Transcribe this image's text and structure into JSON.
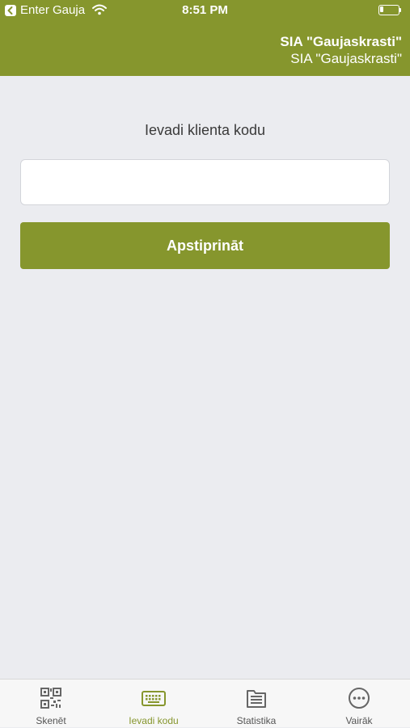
{
  "status_bar": {
    "back_app_label": "Enter Gauja",
    "time": "8:51 PM",
    "battery_level": 0.2
  },
  "header": {
    "company_name": "SIA \"Gaujaskrasti\"",
    "company_subtitle": "SIA \"Gaujaskrasti\""
  },
  "main": {
    "prompt_label": "Ievadi klienta kodu",
    "code_input_value": "",
    "confirm_button_label": "Apstiprināt"
  },
  "tabs": [
    {
      "label": "Skenēt",
      "icon": "qr-code-icon",
      "active": false
    },
    {
      "label": "Ievadi kodu",
      "icon": "keyboard-icon",
      "active": true
    },
    {
      "label": "Statistika",
      "icon": "folder-icon",
      "active": false
    },
    {
      "label": "Vairāk",
      "icon": "more-icon",
      "active": false
    }
  ],
  "colors": {
    "accent": "#86962D",
    "background": "#EBECF0",
    "tab_inactive": "#555555"
  }
}
